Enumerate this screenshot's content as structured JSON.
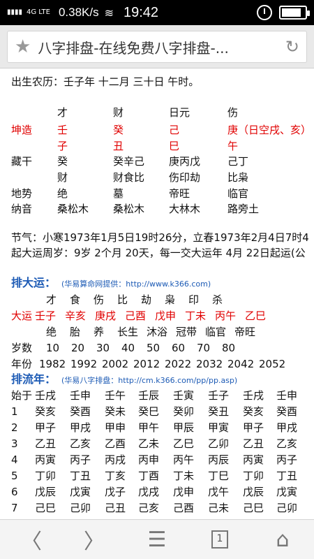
{
  "status": {
    "signal1": "▮▮▮▮",
    "signal2": "4G LTE",
    "netspeed": "0.38K/s",
    "wifi": "≋",
    "time": "19:42",
    "battery": 0.85
  },
  "browser": {
    "title": "八字排盘-在线免费八字排盘-...",
    "star": "★",
    "reload": "↻"
  },
  "content": {
    "birth": "出生农历：壬子年 十二月 三十日 午时。",
    "header_row": [
      "才",
      "财",
      "日元",
      "伤"
    ],
    "kunzao": {
      "label": "坤造",
      "vals": [
        "壬",
        "癸",
        "己",
        "庚（日空戌、亥）"
      ]
    },
    "branches": [
      "子",
      "丑",
      "巳",
      "午"
    ],
    "canggan": {
      "label": "藏干",
      "vals": [
        "癸",
        "癸辛己",
        "庚丙戊",
        "己丁"
      ]
    },
    "canggan2": [
      "财",
      "财食比",
      "伤印劫",
      "比枭"
    ],
    "dishi": {
      "label": "地势",
      "vals": [
        "绝",
        "墓",
        "帝旺",
        "临官"
      ]
    },
    "nayin": {
      "label": "纳音",
      "vals": [
        "桑松木",
        "桑松木",
        "大林木",
        "路旁土"
      ]
    },
    "jieqi": "节气：小寒1973年1月5日19时26分，立春1973年2月4日7时4",
    "qiyun": "起大运周岁：9岁 2个月 20天，每一交大运年 4月 22日起运(公",
    "dayun_title": "排大运：",
    "dayun_src": "(华易算命网提供：http://www.k366.com)",
    "dayun_gods": [
      "才",
      "食",
      "伤",
      "比",
      "劫",
      "枭",
      "印",
      "杀"
    ],
    "dayun_label": "大运",
    "dayun_vals": [
      "壬子",
      "辛亥",
      "庚戌",
      "己酉",
      "戊申",
      "丁未",
      "丙午",
      "乙巳"
    ],
    "dayun_states": [
      "绝",
      "胎",
      "养",
      "长生",
      "沐浴",
      "冠带",
      "临官",
      "帝旺"
    ],
    "age_label": "岁数",
    "ages": [
      "10",
      "20",
      "30",
      "40",
      "50",
      "60",
      "70",
      "80"
    ],
    "year_label": "年份",
    "years": [
      "1982",
      "1992",
      "2002",
      "2012",
      "2022",
      "2032",
      "2042",
      "2052"
    ],
    "liunian_title": "排流年：",
    "liunian_src": "(华易八字排盘：http://cm.k366.com/pp/pp.asp)",
    "liunian_head": [
      "始于",
      "壬戌",
      "壬申",
      "壬午",
      "壬辰",
      "壬寅",
      "壬子",
      "壬戌",
      "壬申"
    ],
    "liunian_rows": [
      [
        "1",
        "癸亥",
        "癸酉",
        "癸未",
        "癸巳",
        "癸卯",
        "癸丑",
        "癸亥",
        "癸酉"
      ],
      [
        "2",
        "甲子",
        "甲戌",
        "甲申",
        "甲午",
        "甲辰",
        "甲寅",
        "甲子",
        "甲戌"
      ],
      [
        "3",
        "乙丑",
        "乙亥",
        "乙酉",
        "乙未",
        "乙巳",
        "乙卯",
        "乙丑",
        "乙亥"
      ],
      [
        "4",
        "丙寅",
        "丙子",
        "丙戌",
        "丙申",
        "丙午",
        "丙辰",
        "丙寅",
        "丙子"
      ],
      [
        "5",
        "丁卯",
        "丁丑",
        "丁亥",
        "丁酉",
        "丁未",
        "丁巳",
        "丁卯",
        "丁丑"
      ],
      [
        "6",
        "戊辰",
        "戊寅",
        "戊子",
        "戊戌",
        "戊申",
        "戊午",
        "戊辰",
        "戊寅"
      ],
      [
        "7",
        "己巳",
        "己卯",
        "己丑",
        "己亥",
        "己酉",
        "己未",
        "己巳",
        "己卯"
      ]
    ]
  },
  "nav": {
    "back": "〈",
    "forward": "〉",
    "menu": "☰",
    "tabs": "1",
    "home": "⌂"
  }
}
